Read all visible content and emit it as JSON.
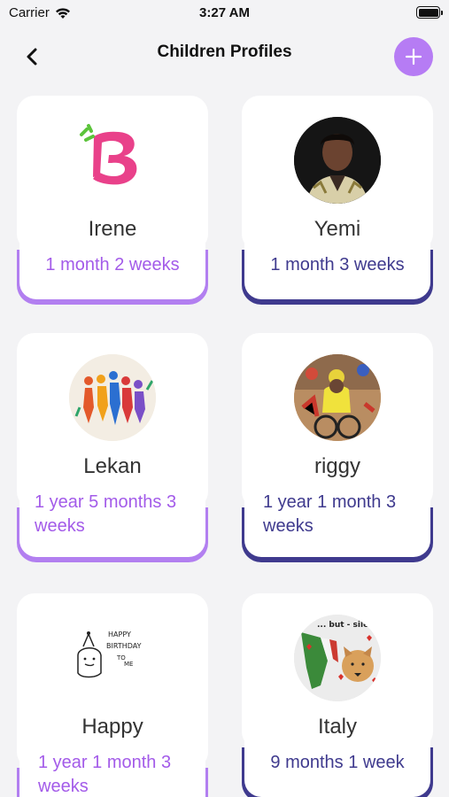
{
  "status_bar": {
    "carrier": "Carrier",
    "time": "3:27 AM"
  },
  "header": {
    "title": "Children Profiles"
  },
  "profiles": [
    {
      "name": "Irene",
      "age": "1 month 2 weeks",
      "accent": "#b27ff0"
    },
    {
      "name": "Yemi",
      "age": "1 month 3 weeks",
      "accent": "#3f3a8e"
    },
    {
      "name": "Lekan",
      "age": "1 year 5 months 3 weeks",
      "accent": "#b27ff0"
    },
    {
      "name": "riggy",
      "age": "1 year 1 month 3 weeks",
      "accent": "#3f3a8e"
    },
    {
      "name": "Happy",
      "age": "1 year 1 month 3 weeks",
      "accent": "#b27ff0"
    },
    {
      "name": "Italy",
      "age": "9 months 1 week",
      "accent": "#3f3a8e"
    }
  ],
  "birthday_drawing_text": [
    "HAPPY",
    "BIRTHDAY",
    "TO",
    "ME"
  ],
  "meme_text": "... but - silent"
}
